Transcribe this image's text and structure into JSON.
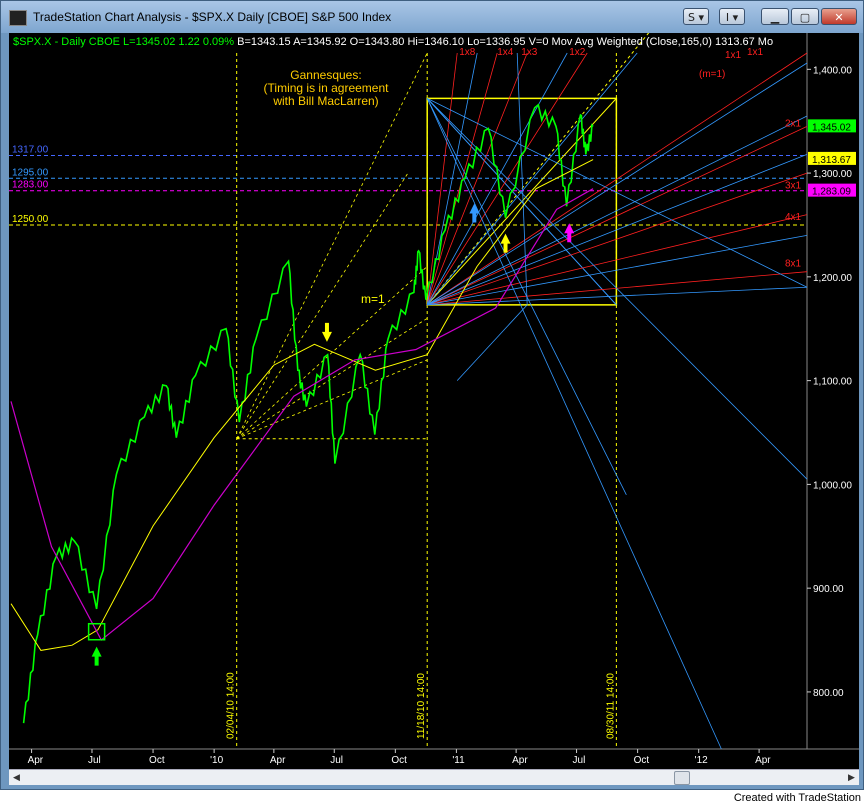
{
  "window": {
    "title": "TradeStation Chart Analysis - $SPX.X Daily [CBOE] S&P 500 Index",
    "buttons": [
      "S",
      "I"
    ],
    "footer": "Created with TradeStation"
  },
  "status": [
    {
      "text": "$SPX.X - Daily  CBOE  L=1345.02  1.22  0.09%",
      "color": "#00ff00"
    },
    {
      "text": "  B=1343.15  A=1345.92  O=1343.80  Hi=1346.10  Lo=1336.95  V=0",
      "color": "#ffffff"
    },
    {
      "text": "  Mov Avg Weighted (Close,165,0)  1313.67  Mo",
      "color": "#ffffff"
    }
  ],
  "colors": {
    "price": "#00ff00",
    "ma_short": "#ffff00",
    "ma_long": "#cc00cc",
    "gann_red": "#ff2020",
    "gann_blue": "#3399ff",
    "box": "#ffff00",
    "level_blue": "#3366ff",
    "level_magenta": "#ff00ff",
    "level_yellow": "#ffff00"
  },
  "chart_data": {
    "type": "line",
    "symbol": "$SPX.X",
    "x_ticks": [
      "Apr",
      "Jul",
      "Oct",
      "'10",
      "Apr",
      "Jul",
      "Oct",
      "'11",
      "Apr",
      "Jul",
      "Oct",
      "'12",
      "Apr"
    ],
    "y_ticks": [
      "1,400.00",
      "1,300.00",
      "1,200.00",
      "1,100.00",
      "1,000.00",
      "900.00",
      "800.00"
    ],
    "y_tick_values": [
      1400,
      1300,
      1200,
      1100,
      1000,
      900,
      800
    ],
    "ylim": [
      745,
      1435
    ],
    "price_series": {
      "name": "$SPX.X",
      "points": [
        [
          "2009-03-20",
          770
        ],
        [
          "2009-04-10",
          855
        ],
        [
          "2009-05-08",
          930
        ],
        [
          "2009-06-05",
          945
        ],
        [
          "2009-07-08",
          880
        ],
        [
          "2009-08-07",
          1010
        ],
        [
          "2009-09-18",
          1065
        ],
        [
          "2009-10-21",
          1095
        ],
        [
          "2009-11-05",
          1045
        ],
        [
          "2009-12-04",
          1105
        ],
        [
          "2010-01-19",
          1150
        ],
        [
          "2010-02-08",
          1060
        ],
        [
          "2010-03-05",
          1140
        ],
        [
          "2010-04-23",
          1215
        ],
        [
          "2010-05-07",
          1110
        ],
        [
          "2010-05-20",
          1075
        ],
        [
          "2010-06-21",
          1125
        ],
        [
          "2010-07-02",
          1020
        ],
        [
          "2010-08-09",
          1125
        ],
        [
          "2010-08-31",
          1048
        ],
        [
          "2010-09-20",
          1140
        ],
        [
          "2010-10-29",
          1185
        ],
        [
          "2010-11-05",
          1225
        ],
        [
          "2010-11-16",
          1178
        ],
        [
          "2010-12-15",
          1245
        ],
        [
          "2011-01-14",
          1295
        ],
        [
          "2011-02-18",
          1343
        ],
        [
          "2011-03-16",
          1257
        ],
        [
          "2011-04-29",
          1363
        ],
        [
          "2011-05-31",
          1345
        ],
        [
          "2011-06-16",
          1268
        ],
        [
          "2011-07-07",
          1356
        ],
        [
          "2011-07-15",
          1318
        ],
        [
          "2011-07-26",
          1345
        ]
      ]
    },
    "wma165_series": {
      "name": "Mov Avg Weighted (Close,165,0)",
      "value_label": "1,313.67",
      "points": [
        [
          "2009-03-01",
          885
        ],
        [
          "2009-04-15",
          840
        ],
        [
          "2009-06-01",
          845
        ],
        [
          "2009-07-10",
          860
        ],
        [
          "2009-10-01",
          960
        ],
        [
          "2010-01-01",
          1045
        ],
        [
          "2010-04-01",
          1115
        ],
        [
          "2010-06-01",
          1135
        ],
        [
          "2010-09-01",
          1110
        ],
        [
          "2010-11-18",
          1125
        ],
        [
          "2011-02-01",
          1210
        ],
        [
          "2011-05-01",
          1285
        ],
        [
          "2011-07-26",
          1313
        ]
      ]
    },
    "wma_long_series": {
      "points": [
        [
          "2009-03-01",
          1080
        ],
        [
          "2009-05-01",
          940
        ],
        [
          "2009-07-15",
          850
        ],
        [
          "2009-10-01",
          890
        ],
        [
          "2010-01-01",
          980
        ],
        [
          "2010-05-01",
          1085
        ],
        [
          "2010-08-01",
          1120
        ],
        [
          "2010-11-01",
          1130
        ],
        [
          "2011-03-01",
          1170
        ],
        [
          "2011-06-01",
          1265
        ],
        [
          "2011-07-26",
          1285
        ]
      ]
    },
    "levels": [
      {
        "label": "1317.00",
        "value": 1317,
        "color": "#4466ff"
      },
      {
        "label": "1295.00",
        "value": 1295,
        "color": "#3399ff"
      },
      {
        "label": "1283.00",
        "value": 1283,
        "color": "#ff00ff"
      },
      {
        "label": "1250.00",
        "value": 1250,
        "color": "#ffff00"
      }
    ],
    "price_labels": [
      {
        "text": "1,345.02",
        "value": 1345.02,
        "bg": "#00ff00"
      },
      {
        "text": "1,313.67",
        "value": 1313.67,
        "bg": "#ffff00"
      },
      {
        "text": "1,283.09",
        "value": 1283.09,
        "bg": "#ff00ff"
      }
    ],
    "vertical_markers": [
      {
        "label": "02/04/10 14:00",
        "date": "2010-02-04"
      },
      {
        "label": "11/18/10 14:00",
        "date": "2010-11-18"
      },
      {
        "label": "08/30/11 14:00",
        "date": "2011-08-30"
      }
    ],
    "gann_box": {
      "x_start": "2010-11-18",
      "x_end": "2011-08-30",
      "y_low": 1173,
      "y_high": 1372
    },
    "gann_box_2010": {
      "x_start": "2010-02-04",
      "x_end": "2010-11-18",
      "y_low": 1044
    },
    "gann_labels": [
      "1x8",
      "1x4",
      "1x3",
      "1x2",
      "1x1",
      "1x1",
      "(m=1)",
      "2x1",
      "3x1",
      "4x1",
      "8x1"
    ],
    "annotations": {
      "gannesques": "Gannesques:",
      "timing": "(Timing is in agreement",
      "maclarren": "with Bill MacLarren)",
      "m1": "m=1"
    },
    "arrows": [
      {
        "date": "2009-07-08",
        "value": 835,
        "color": "#00ff00",
        "direction": "up"
      },
      {
        "date": "2010-06-20",
        "value": 1146,
        "color": "#ffff00",
        "direction": "down"
      },
      {
        "date": "2011-01-28",
        "value": 1262,
        "color": "#3399ff",
        "direction": "up"
      },
      {
        "date": "2011-03-16",
        "value": 1233,
        "color": "#ffff00",
        "direction": "up"
      },
      {
        "date": "2011-06-20",
        "value": 1243,
        "color": "#ff00ff",
        "direction": "up"
      }
    ]
  }
}
